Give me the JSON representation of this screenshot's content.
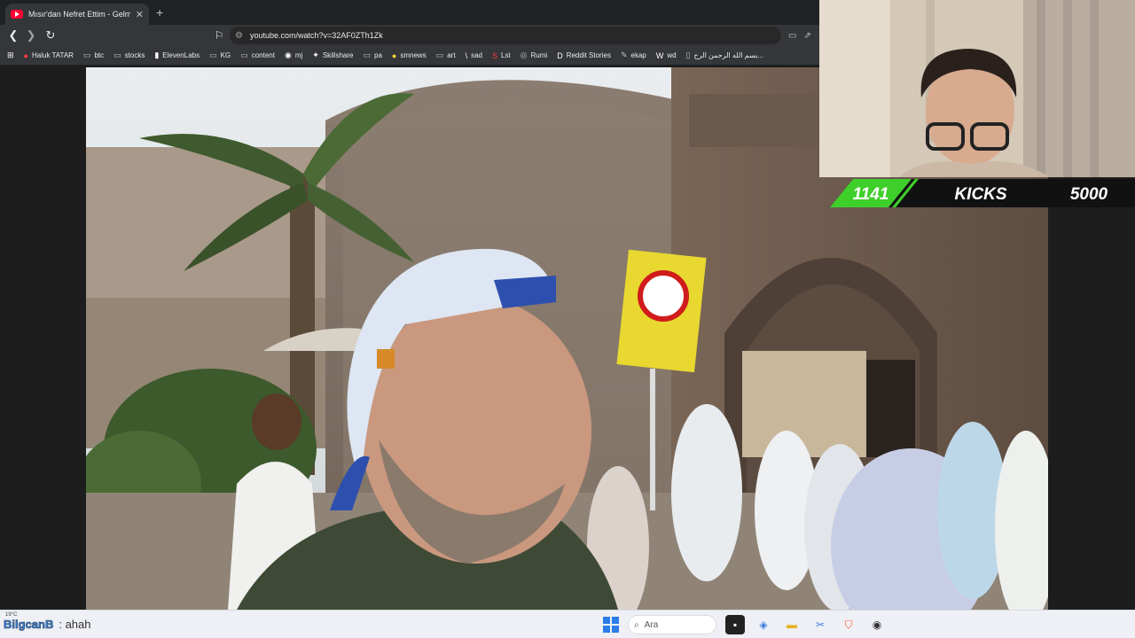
{
  "browser": {
    "tab_title": "Mısır'dan Nefret Ettim - Gelm",
    "new_tab": "+",
    "url": "youtube.com/watch?v=32AF0ZTh1Zk"
  },
  "bookmarks": [
    {
      "label": "Haluk TATAR",
      "icon": "youtube-icon"
    },
    {
      "label": "btc",
      "icon": "folder-icon"
    },
    {
      "label": "stocks",
      "icon": "folder-icon"
    },
    {
      "label": "ElevenLabs",
      "icon": "elevenlabs-icon"
    },
    {
      "label": "KG",
      "icon": "folder-icon"
    },
    {
      "label": "content",
      "icon": "folder-icon"
    },
    {
      "label": "mj",
      "icon": "github-icon"
    },
    {
      "label": "Skillshare",
      "icon": "skillshare-icon"
    },
    {
      "label": "pa",
      "icon": "folder-icon"
    },
    {
      "label": "smnews",
      "icon": "smiley-icon"
    },
    {
      "label": "art",
      "icon": "folder-icon"
    },
    {
      "label": "sad",
      "icon": "slash-icon"
    },
    {
      "label": "Lst",
      "icon": "s-icon"
    },
    {
      "label": "Rumi",
      "icon": "globe-icon"
    },
    {
      "label": "Reddit Stories",
      "icon": "d-icon"
    },
    {
      "label": "ekap",
      "icon": "bird-icon"
    },
    {
      "label": "wd",
      "icon": "wiki-icon"
    },
    {
      "label": "بسم الله الرحمن الرح...",
      "icon": "page-icon"
    }
  ],
  "overlay": {
    "count": "1141",
    "label": "KICKS",
    "goal": "5000"
  },
  "chat": {
    "weather": "19°C",
    "username": "BilgcanB",
    "message": ": ahah"
  },
  "taskbar": {
    "search_placeholder": "Ara"
  },
  "colors": {
    "kicks_green": "#3fcf2a",
    "browser_dark": "#35363a",
    "taskbar_bg": "#eef0f5"
  }
}
